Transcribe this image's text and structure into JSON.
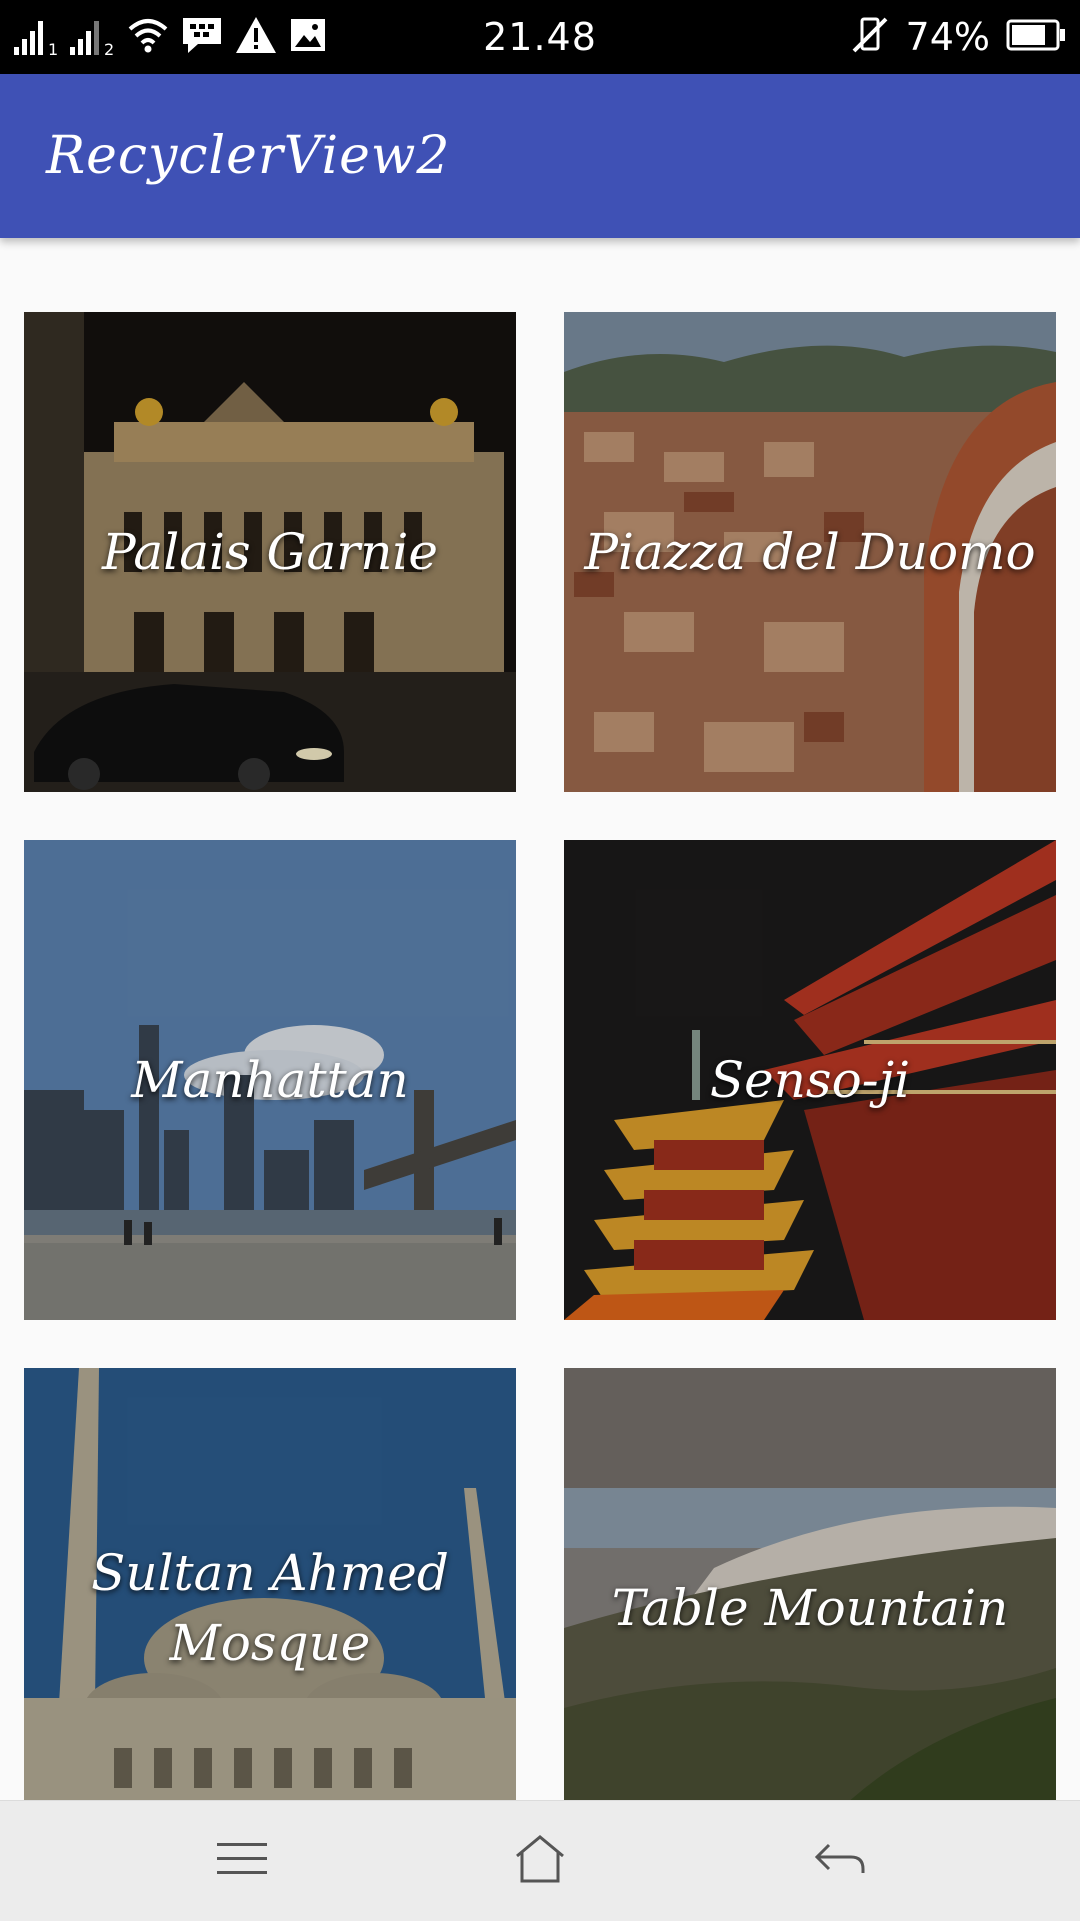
{
  "status_bar": {
    "time": "21.48",
    "battery_percent": "74%",
    "sim1_label": "1",
    "sim2_label": "2",
    "icons": [
      "signal-sim1-icon",
      "signal-sim2-icon",
      "wifi-icon",
      "bbm-icon",
      "warning-icon",
      "image-icon",
      "vibrate-icon",
      "battery-icon"
    ]
  },
  "app_bar": {
    "title": "RecyclerView2",
    "color": "#3f51b5"
  },
  "places": [
    {
      "label": "Palais Garnie"
    },
    {
      "label": "Piazza del Duomo"
    },
    {
      "label": "Manhattan"
    },
    {
      "label": "Senso-ji"
    },
    {
      "label": "Sultan Ahmed Mosque"
    },
    {
      "label": "Table Mountain"
    }
  ],
  "nav_bar": {
    "icons": [
      "menu-icon",
      "home-icon",
      "back-icon"
    ]
  }
}
